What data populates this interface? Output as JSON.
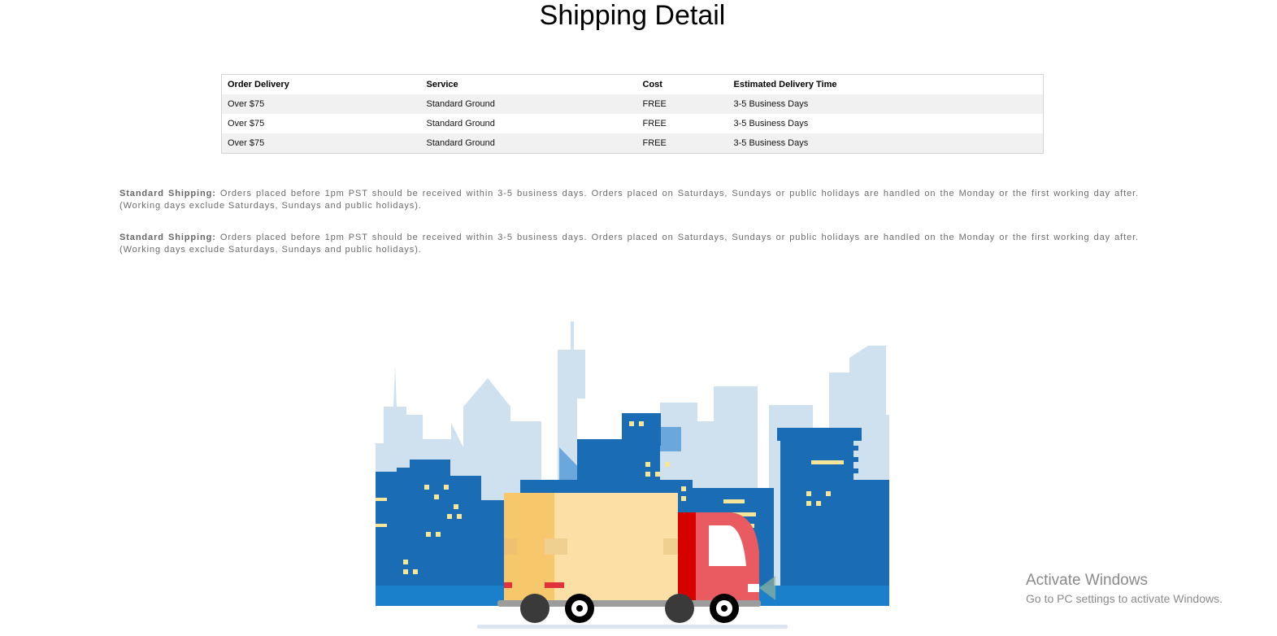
{
  "page": {
    "title": "Shipping Detail"
  },
  "table": {
    "headers": [
      "Order Delivery",
      "Service",
      "Cost",
      "Estimated Delivery Time"
    ],
    "rows": [
      [
        "Over $75",
        "Standard Ground",
        "FREE",
        "3-5 Business Days"
      ],
      [
        "Over $75",
        "Standard Ground",
        "FREE",
        "3-5 Business Days"
      ],
      [
        "Over $75",
        "Standard Ground",
        "FREE",
        "3-5 Business Days"
      ]
    ]
  },
  "policies": [
    {
      "label": "Standard Shipping:",
      "text": " Orders placed before 1pm PST should be received within 3-5 business days. Orders placed on Saturdays, Sundays or public holidays are handled on the Monday or the first working day after. (Working days exclude Saturdays, Sundays and public holidays)."
    },
    {
      "label": "Standard Shipping:",
      "text": " Orders placed before 1pm PST should be received within 3-5 business days. Orders placed on Saturdays, Sundays or public holidays are handled on the Monday or the first working day after. (Working days exclude Saturdays, Sundays and public holidays)."
    }
  ],
  "illustration": {
    "icon": "delivery-truck-city-illustration",
    "colors": {
      "sky_buildings": "#cfe0ef",
      "buildings": "#1a6db5",
      "windows": "#f7e59a",
      "truck_box": "#fbdfa4",
      "truck_box_side": "#f6c86b",
      "truck_cab": "#e95b61",
      "truck_stripe": "#d60000",
      "wheel": "#000000"
    }
  },
  "watermark": {
    "title": "Activate Windows",
    "subtitle": "Go to PC settings to activate Windows."
  }
}
